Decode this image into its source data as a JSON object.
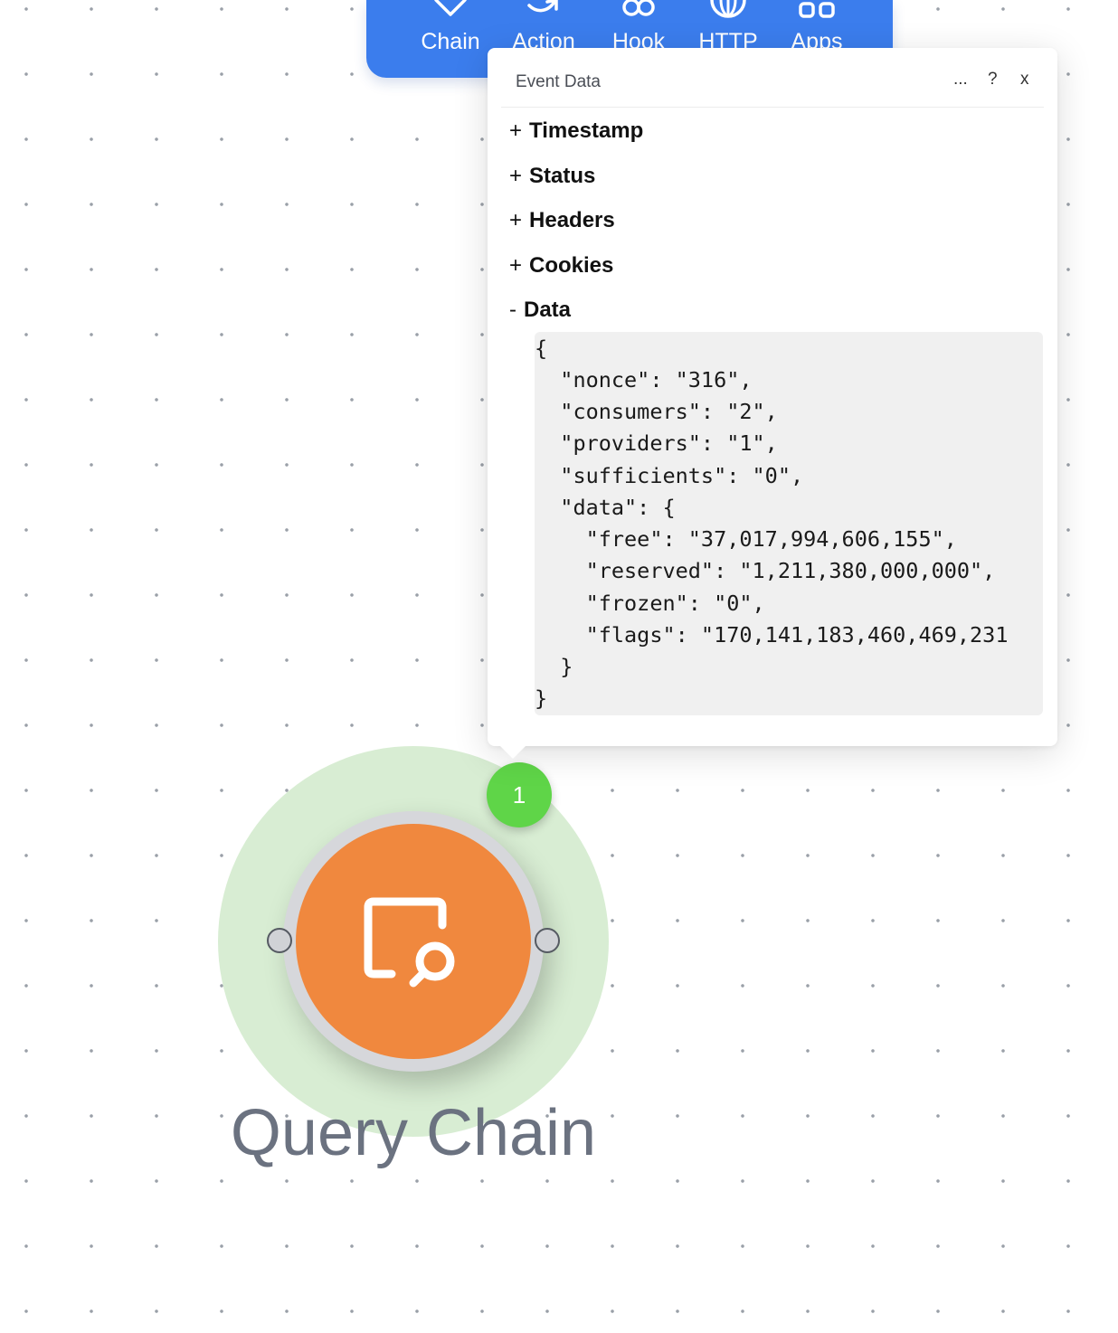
{
  "toolbar": {
    "items": [
      {
        "label": "Chain",
        "icon": "chain-icon"
      },
      {
        "label": "Action",
        "icon": "action-icon"
      },
      {
        "label": "Hook",
        "icon": "hook-icon"
      },
      {
        "label": "HTTP",
        "icon": "globe-icon"
      },
      {
        "label": "Apps",
        "icon": "apps-icon"
      }
    ]
  },
  "popover": {
    "title": "Event Data",
    "more_label": "...",
    "help_label": "?",
    "close_label": "x",
    "sections": [
      {
        "sign": "+",
        "label": "Timestamp"
      },
      {
        "sign": "+",
        "label": "Status"
      },
      {
        "sign": "+",
        "label": "Headers"
      },
      {
        "sign": "+",
        "label": "Cookies"
      },
      {
        "sign": "-",
        "label": "Data"
      }
    ],
    "code_lines": [
      "{",
      "  \"nonce\": \"316\",",
      "  \"consumers\": \"2\",",
      "  \"providers\": \"1\",",
      "  \"sufficients\": \"0\",",
      "  \"data\": {",
      "    \"free\": \"37,017,994,606,155\",",
      "    \"reserved\": \"1,211,380,000,000\",",
      "    \"frozen\": \"0\",",
      "    \"flags\": \"170,141,183,460,469,231",
      "  }",
      "}"
    ]
  },
  "node": {
    "label": "Query Chain",
    "badge_count": "1",
    "icon": "query-search-icon",
    "colors": {
      "core": "#f0883e",
      "halo": "#d8edd3",
      "badge": "#5fd548"
    }
  }
}
